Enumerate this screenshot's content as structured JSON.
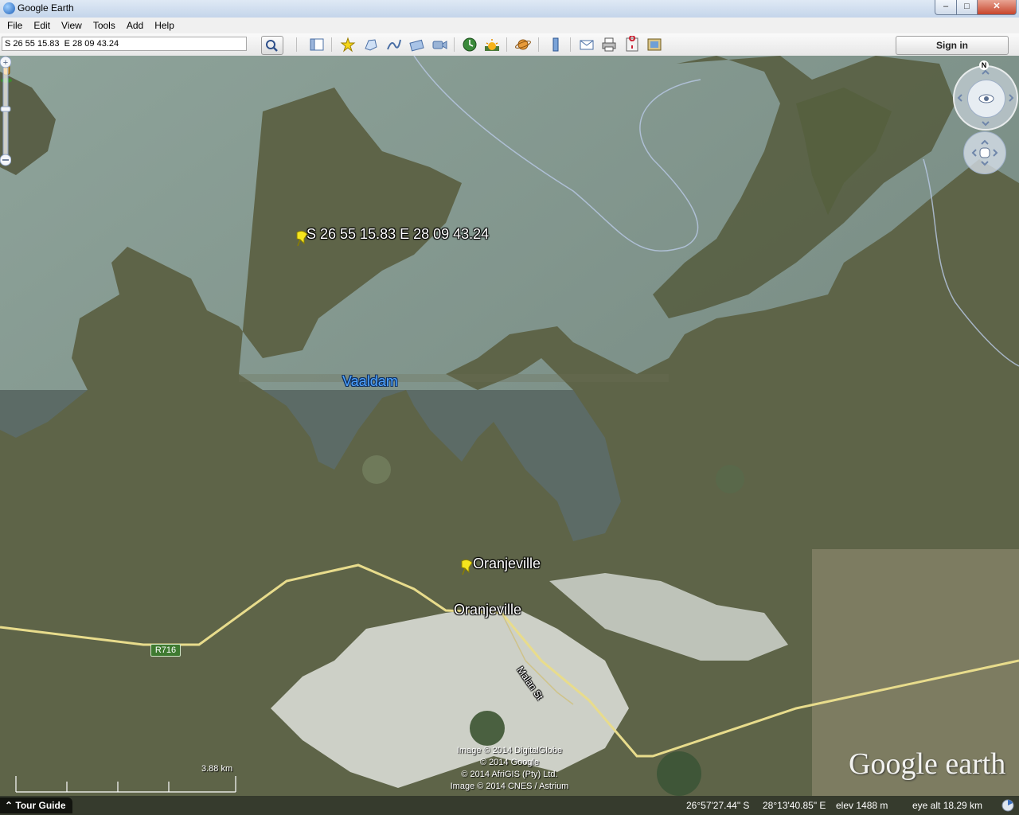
{
  "window": {
    "title": "Google Earth",
    "min_label": "–",
    "max_label": "□",
    "close_label": "✕"
  },
  "menu": [
    "File",
    "Edit",
    "View",
    "Tools",
    "Add",
    "Help"
  ],
  "search": {
    "value": "S 26 55 15.83  E 28 09 43.24"
  },
  "toolbar": {
    "icons": [
      "sidebar-icon",
      "placemark-icon",
      "polygon-icon",
      "path-icon",
      "image-overlay-icon",
      "record-tour-icon",
      "historical-imagery-icon",
      "sunlight-icon",
      "planets-icon",
      "ruler-icon",
      "email-icon",
      "print-icon",
      "google-maps-icon",
      "kml-icon"
    ],
    "sign_in": "Sign in"
  },
  "map": {
    "labels": {
      "placemark_coords": "S 26 55 15.83  E 28 09 43.24",
      "vaaldam": "Vaaldam",
      "placemark_town": "Oranjeville",
      "town": "Oranjeville",
      "road": "Malan St",
      "route": "R716"
    },
    "credits": [
      "Image © 2014 DigitalGlobe",
      "© 2014 Google",
      "© 2014 AfriGIS (Pty) Ltd.",
      "Image © 2014 CNES / Astrium"
    ],
    "logo": "Google earth",
    "scale": "3.88 km"
  },
  "nav": {
    "north": "N"
  },
  "status": {
    "tour_guide": "Tour Guide",
    "lat": "26°57'27.44\" S",
    "lon": "28°13'40.85\" E",
    "elev": "elev  1488 m",
    "eye_alt": "eye alt  18.29 km"
  },
  "colors": {
    "water": "#7f9488",
    "land": "#5d6248",
    "road": "#e8dc8c",
    "placemark": "#f5e51e"
  }
}
